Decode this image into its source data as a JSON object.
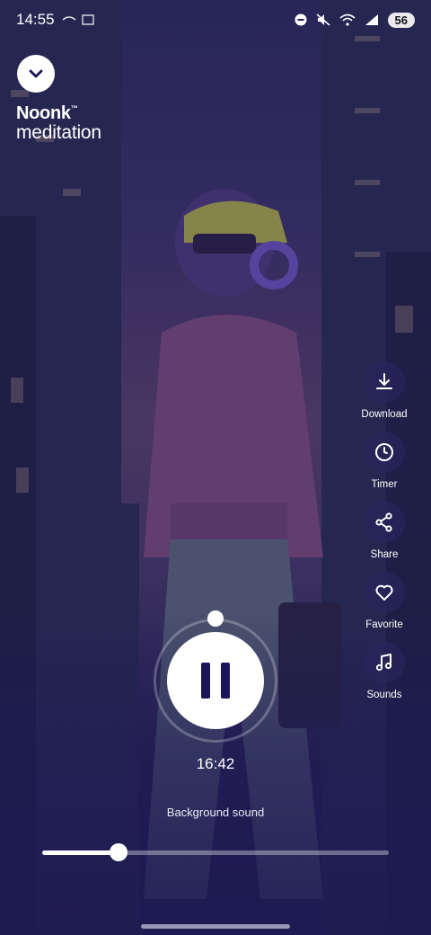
{
  "status_bar": {
    "time": "14:55",
    "battery": "56"
  },
  "header": {
    "collapse_icon": "chevron-down-icon",
    "logo_line1": "Noonk",
    "logo_tm": "™",
    "logo_line2": "meditation"
  },
  "actions": [
    {
      "label": "Download",
      "icon": "download-icon"
    },
    {
      "label": "Timer",
      "icon": "clock-icon"
    },
    {
      "label": "Share",
      "icon": "share-icon"
    },
    {
      "label": "Favorite",
      "icon": "heart-icon"
    },
    {
      "label": "Sounds",
      "icon": "music-note-icon"
    }
  ],
  "player": {
    "state": "playing",
    "time_remaining": "16:42",
    "background_sound_label": "Background sound",
    "background_sound_volume": 0.22
  },
  "colors": {
    "accent": "#1a1658",
    "overlay": "#241d52"
  }
}
